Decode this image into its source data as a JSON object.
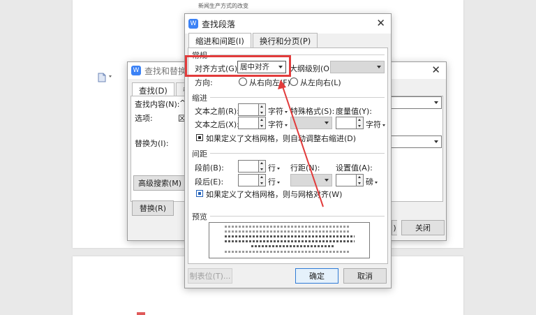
{
  "doc": {
    "top_caption": "新闻生产方式的改变",
    "find_replace_menu_icon": "document-icon"
  },
  "find_replace": {
    "title": "查找和替换",
    "tabs": [
      "查找(D)",
      "替"
    ],
    "find_label": "查找内容(N):",
    "find_value": "^",
    "options_label": "选项:",
    "options_value": "区",
    "replace_label": "替换为(I):",
    "advanced_button": "高级搜索(M)",
    "replace_button": "替换(R)",
    "close_button": "关闭",
    "prev_button": ")"
  },
  "para": {
    "title": "查找段落",
    "tabs": {
      "indent": "缩进和间距(I)",
      "linebreak": "换行和分页(P)"
    },
    "sections": {
      "general": "常规",
      "indent": "缩进",
      "spacing": "间距",
      "preview": "预览"
    },
    "align_label": "对齐方式(G):",
    "align_value": "居中对齐",
    "outline_label": "大纲级别(O):",
    "direction_label": "方向:",
    "rtl_label": "从右向左(F)",
    "ltr_label": "从左向右(L)",
    "before_text_label": "文本之前(R):",
    "after_text_label": "文本之后(X):",
    "char_unit": "字符",
    "special_label": "特殊格式(S):",
    "measure_label": "度量值(Y):",
    "indent_grid_label": "如果定义了文档网格，则自动调整右缩进(D)",
    "before_para_label": "段前(B):",
    "after_para_label": "段后(E):",
    "line_unit": "行",
    "line_spacing_label": "行距(N):",
    "setting_label": "设置值(A):",
    "pound_unit": "磅",
    "snap_grid_label": "如果定义了文档网格，则与网格对齐(W)",
    "tabs_button": "制表位(T)...",
    "ok_button": "确定",
    "cancel_button": "取消"
  },
  "colors": {
    "highlight": "#e23b3b",
    "accent": "#3b82f6"
  }
}
